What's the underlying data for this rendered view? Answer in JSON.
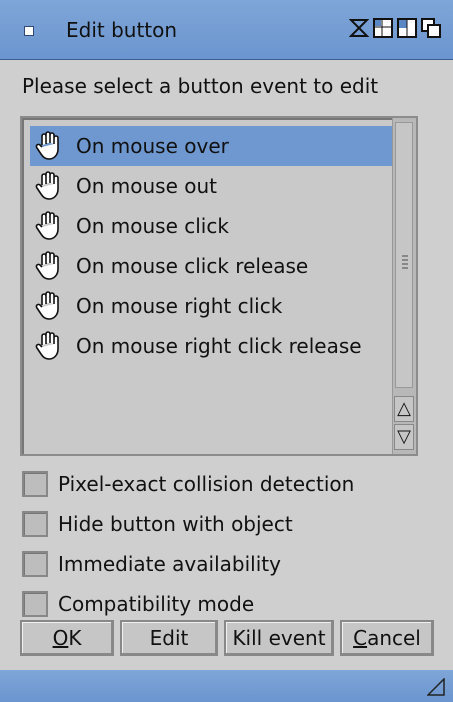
{
  "window": {
    "title": "Edit button"
  },
  "prompt": "Please select a button event to edit",
  "events": [
    {
      "label": "On mouse over",
      "selected": true
    },
    {
      "label": "On mouse out",
      "selected": false
    },
    {
      "label": "On mouse click",
      "selected": false
    },
    {
      "label": "On mouse click release",
      "selected": false
    },
    {
      "label": "On mouse right click",
      "selected": false
    },
    {
      "label": "On mouse right click release",
      "selected": false
    }
  ],
  "options": [
    {
      "label": "Pixel-exact collision detection",
      "checked": false
    },
    {
      "label": "Hide button with object",
      "checked": false
    },
    {
      "label": "Immediate availability",
      "checked": false
    },
    {
      "label": "Compatibility mode",
      "checked": false
    }
  ],
  "buttons": {
    "ok": {
      "mnemonic": "O",
      "rest": "K"
    },
    "edit": "Edit",
    "kill": "Kill event",
    "cancel": {
      "mnemonic": "C",
      "rest": "ancel"
    }
  },
  "icons": {
    "close": "close-gadget-icon",
    "iconify": "iconify-gadget-icon",
    "zoom": "zoom-gadget-icon",
    "depth1": "depth-gadget-icon",
    "depth2": "depth-front-gadget-icon",
    "event": "hand-pointer-icon",
    "scroll_up": "scroll-up-icon",
    "scroll_down": "scroll-down-icon",
    "resize": "resize-handle-icon"
  },
  "colors": {
    "titlebar": "#7fa6d8",
    "selection": "#6e98cf",
    "window_bg": "#cfcfcf"
  }
}
